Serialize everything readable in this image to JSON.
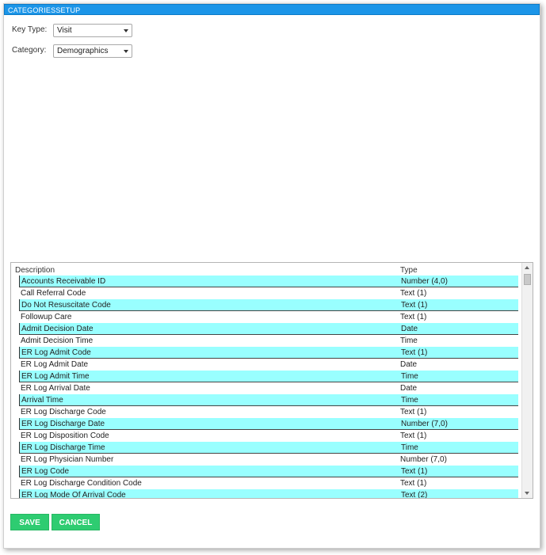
{
  "dialog": {
    "title": "CATEGORIESSETUP"
  },
  "form": {
    "key_type_label": "Key Type:",
    "key_type_value": "Visit",
    "category_label": "Category:",
    "category_value": "Demographics"
  },
  "grid": {
    "col_description": "Description",
    "col_type": "Type",
    "rows": [
      {
        "description": "Accounts Receivable ID",
        "type": "Number (4,0)"
      },
      {
        "description": "Call Referral Code",
        "type": "Text (1)"
      },
      {
        "description": "Do Not Resuscitate Code",
        "type": "Text (1)"
      },
      {
        "description": "Followup Care",
        "type": "Text (1)"
      },
      {
        "description": "Admit Decision Date",
        "type": "Date"
      },
      {
        "description": "Admit Decision Time",
        "type": "Time"
      },
      {
        "description": "ER Log Admit Code",
        "type": "Text (1)"
      },
      {
        "description": "ER Log Admit Date",
        "type": "Date"
      },
      {
        "description": "ER Log Admit Time",
        "type": "Time"
      },
      {
        "description": "ER Log Arrival Date",
        "type": "Date"
      },
      {
        "description": "Arrival Time",
        "type": "Time"
      },
      {
        "description": "ER Log Discharge Code",
        "type": "Text (1)"
      },
      {
        "description": "ER Log Discharge Date",
        "type": "Number (7,0)"
      },
      {
        "description": "ER Log Disposition Code",
        "type": "Text (1)"
      },
      {
        "description": "ER Log Discharge Time",
        "type": "Time"
      },
      {
        "description": "ER Log Physician Number",
        "type": "Number (7,0)"
      },
      {
        "description": "ER Log Code",
        "type": "Text (1)"
      },
      {
        "description": "ER Log Discharge Condition Code",
        "type": "Text (1)"
      },
      {
        "description": "ER Log Mode Of Arrival Code",
        "type": "Text (2)"
      }
    ]
  },
  "buttons": {
    "save": "SAVE",
    "cancel": "CANCEL"
  },
  "colors": {
    "titlebar": "#1b95e8",
    "row_highlight": "#99ffff",
    "button": "#2ecc71"
  }
}
